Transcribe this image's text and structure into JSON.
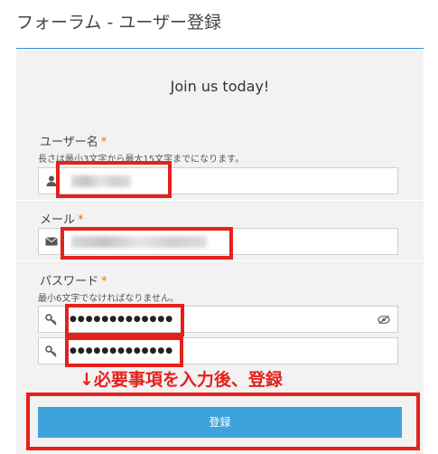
{
  "page": {
    "title": "フォーラム - ユーザー登録"
  },
  "form": {
    "heading": "Join us today!",
    "username": {
      "label": "ユーザー名",
      "required_mark": "*",
      "hint": "長さは最小3文字から最大15文字までになります。",
      "icon": "user-icon"
    },
    "email": {
      "label": "メール",
      "required_mark": "*",
      "icon": "envelope-icon"
    },
    "password": {
      "label": "パスワード",
      "required_mark": "*",
      "hint": "最小6文字でなければなりません。",
      "value": "●●●●●●●●●●●●●",
      "icon": "key-icon",
      "toggle_icon": "eye-slash-icon"
    },
    "password_confirm": {
      "value": "●●●●●●●●●●●●●",
      "icon": "key-icon"
    },
    "submit_label": "登録"
  },
  "annotation": {
    "text": "↓必要事項を入力後、登録",
    "color": "#e5211b"
  },
  "colors": {
    "accent": "#3ea3db",
    "rule": "#2b8fd6",
    "highlight": "#e5211b"
  }
}
